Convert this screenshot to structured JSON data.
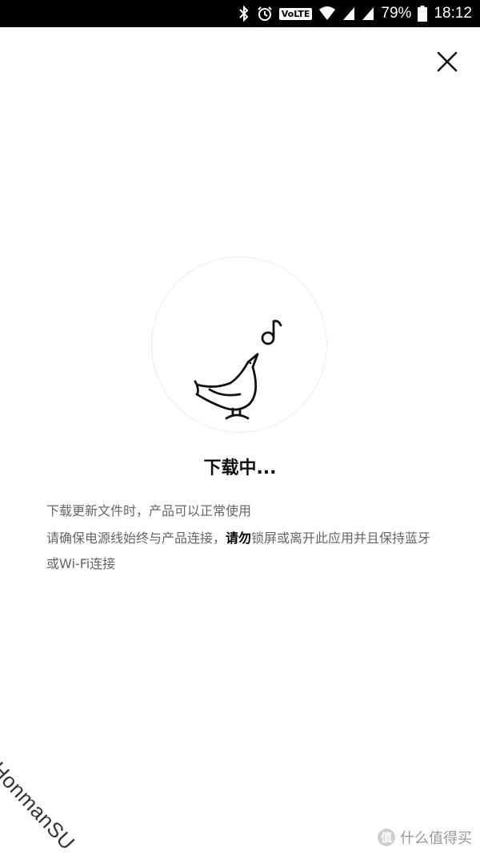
{
  "status_bar": {
    "network_badge": "VoLTE",
    "battery_percent": "79%",
    "time": "18:12"
  },
  "download": {
    "title": "下载中...",
    "line1": "下载更新文件时，产品可以正常使用",
    "line2_part1": "请确保电源线始终与产品连接，",
    "line2_emphasis": "请勿",
    "line2_part2": "锁屏或离开此应用并且保持蓝牙或Wi-Fi连接"
  },
  "watermark": {
    "text": "HonmanSU"
  },
  "site_badge": {
    "icon_text": "值",
    "label": "什么值得买"
  },
  "icons": {
    "close": "close-icon",
    "bird": "singing-bird-icon",
    "note": "music-note-icon"
  }
}
